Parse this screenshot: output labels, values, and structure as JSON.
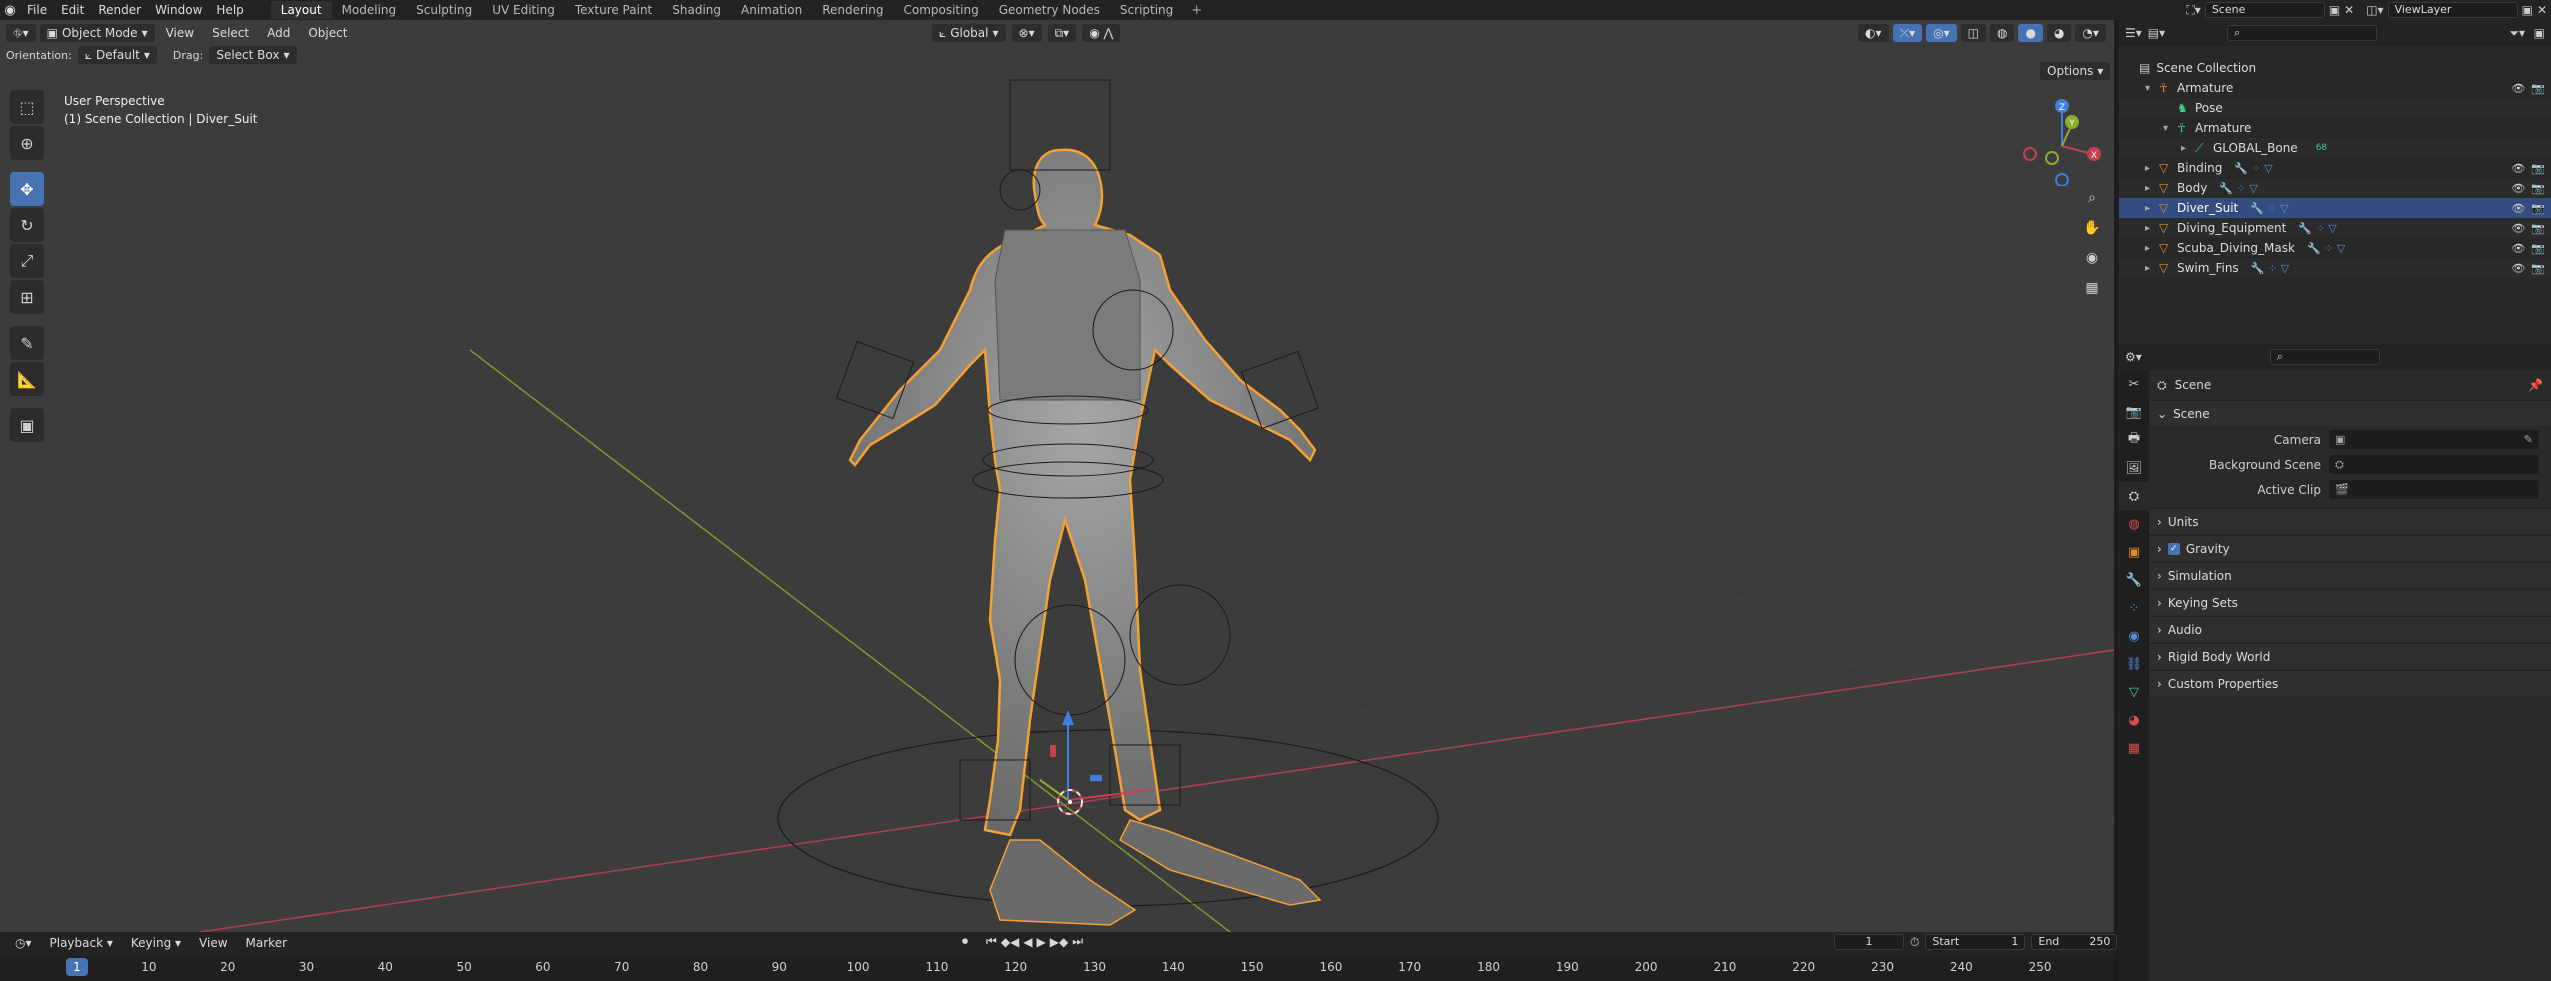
{
  "topbar": {
    "menus": [
      "File",
      "Edit",
      "Render",
      "Window",
      "Help"
    ],
    "workspaces": [
      "Layout",
      "Modeling",
      "Sculpting",
      "UV Editing",
      "Texture Paint",
      "Shading",
      "Animation",
      "Rendering",
      "Compositing",
      "Geometry Nodes",
      "Scripting"
    ],
    "active_workspace": "Layout",
    "add_label": "+",
    "scene_value": "Scene",
    "viewlayer_value": "ViewLayer"
  },
  "viewport": {
    "mode": "Object Mode",
    "menus": [
      "View",
      "Select",
      "Add",
      "Object"
    ],
    "transform_orientation": "Global",
    "orientation_label": "Orientation:",
    "orientation_value": "Default",
    "drag_label": "Drag:",
    "drag_value": "Select Box",
    "options_label": "Options",
    "perspective_text": "User Perspective",
    "collection_text": "(1) Scene Collection | Diver_Suit",
    "gizmo_axes": {
      "x": "X",
      "y": "Y",
      "z": "Z"
    }
  },
  "timeline": {
    "menus": [
      "Playback",
      "Keying",
      "View",
      "Marker"
    ],
    "current_frame": "1",
    "start_label": "Start",
    "start_value": "1",
    "end_label": "End",
    "end_value": "250",
    "ticks": [
      "10",
      "20",
      "30",
      "40",
      "50",
      "60",
      "70",
      "80",
      "90",
      "100",
      "110",
      "120",
      "130",
      "140",
      "150",
      "160",
      "170",
      "180",
      "190",
      "200",
      "210",
      "220",
      "230",
      "240",
      "250"
    ],
    "ruler_current": "1"
  },
  "outliner": {
    "root": "Scene Collection",
    "items": [
      {
        "label": "Armature",
        "indent": 1,
        "icon": "armature-icon"
      },
      {
        "label": "Pose",
        "indent": 2,
        "icon": "pose-icon"
      },
      {
        "label": "Armature",
        "indent": 2,
        "icon": "armature-data-icon"
      },
      {
        "label": "GLOBAL_Bone",
        "indent": 3,
        "icon": "bone-icon",
        "badge": "68"
      },
      {
        "label": "Binding",
        "indent": 1,
        "icon": "mesh-icon"
      },
      {
        "label": "Body",
        "indent": 1,
        "icon": "mesh-icon"
      },
      {
        "label": "Diver_Suit",
        "indent": 1,
        "icon": "mesh-icon",
        "selected": true
      },
      {
        "label": "Diving_Equipment",
        "indent": 1,
        "icon": "mesh-icon"
      },
      {
        "label": "Scuba_Diving_Mask",
        "indent": 1,
        "icon": "mesh-icon"
      },
      {
        "label": "Swim_Fins",
        "indent": 1,
        "icon": "mesh-icon"
      }
    ]
  },
  "properties": {
    "context_title": "Scene",
    "scene_panel": "Scene",
    "fields": [
      {
        "label": "Camera",
        "value": ""
      },
      {
        "label": "Background Scene",
        "value": ""
      },
      {
        "label": "Active Clip",
        "value": ""
      }
    ],
    "panels": [
      "Units",
      "Gravity",
      "Simulation",
      "Keying Sets",
      "Audio",
      "Rigid Body World",
      "Custom Properties"
    ]
  },
  "colors": {
    "accent": "#4772b3",
    "selection_outline": "#f5a033",
    "x_axis": "#c8404e",
    "y_axis": "#8aad2c",
    "z_axis": "#3f7fe0"
  }
}
